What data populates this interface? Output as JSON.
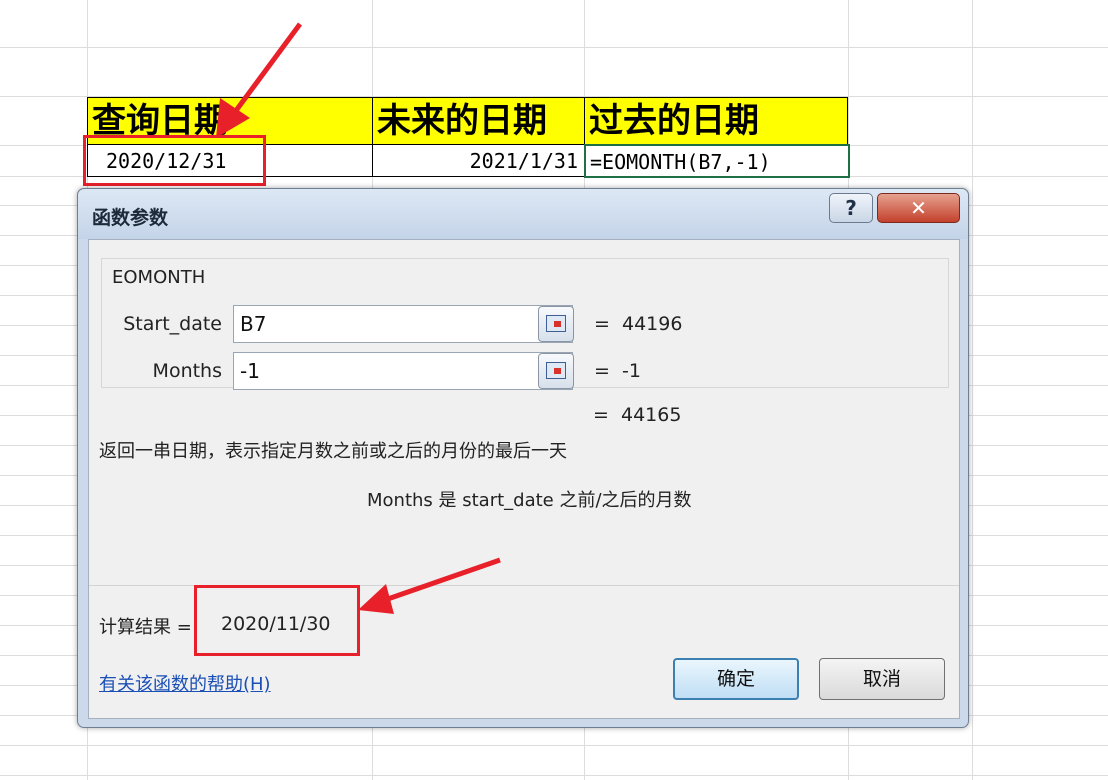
{
  "sheet": {
    "headers": [
      "查询日期",
      "未来的日期",
      "过去的日期"
    ],
    "row": {
      "query_date": "2020/12/31",
      "future_date": "2021/1/31",
      "past_formula": "=EOMONTH(B7,-1)"
    }
  },
  "dialog": {
    "title": "函数参数",
    "help_glyph": "?",
    "close_glyph": "✕",
    "function_name": "EOMONTH",
    "args": [
      {
        "label": "Start_date",
        "value": "B7",
        "eval": "44196"
      },
      {
        "label": "Months",
        "value": "-1",
        "eval": "-1"
      }
    ],
    "equals": "=",
    "result_value": "44165",
    "description": "返回一串日期，表示指定月数之前或之后的月份的最后一天",
    "arg_help": "Months 是 start_date 之前/之后的月数",
    "calc_label": "计算结果 =",
    "calc_result": "2020/11/30",
    "help_link": "有关该函数的帮助(H)",
    "ok_label": "确定",
    "cancel_label": "取消"
  },
  "colors": {
    "header_fill": "#ffff00",
    "annotation_red": "#e8202a",
    "active_cell_border": "#1e7145"
  }
}
